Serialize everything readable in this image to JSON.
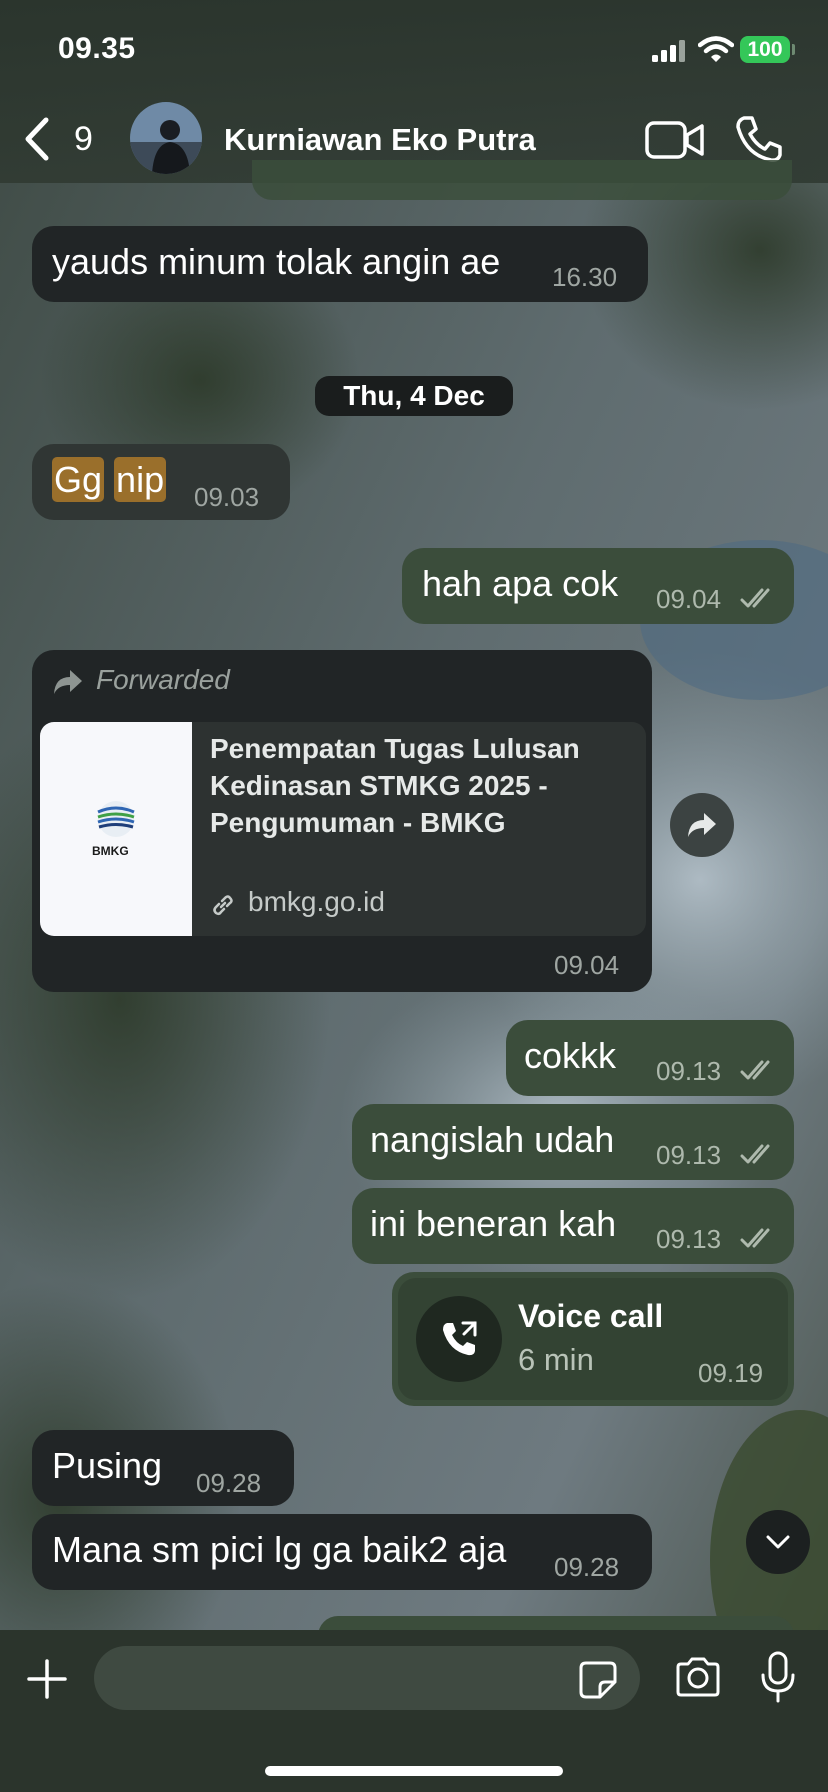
{
  "status": {
    "time": "09.35",
    "battery": "100"
  },
  "header": {
    "back_count": "9",
    "contact_name": "Kurniawan Eko Putra"
  },
  "date_separator": "Thu, 4 Dec",
  "messages": [
    {
      "direction": "in",
      "text": "yauds minum tolak angin ae",
      "time": "16.30"
    },
    {
      "direction": "in",
      "text_parts": [
        "Gg",
        "nip"
      ],
      "time": "09.03"
    },
    {
      "direction": "out",
      "text": "hah apa cok",
      "time": "09.04",
      "status": "read"
    },
    {
      "direction": "in",
      "forwarded_label": "Forwarded",
      "link_title": "Penempatan Tugas Lulusan Kedinasan STMKG 2025 - Pengumuman - BMKG",
      "link_title_lines": [
        "Penempatan Tugas Lulusan",
        "Kedinasan STMKG 2025 -",
        "Pengumuman - BMKG"
      ],
      "link_domain": "bmkg.go.id",
      "logo_text": "BMKG",
      "time": "09.04"
    },
    {
      "direction": "out",
      "text": "cokkk",
      "time": "09.13",
      "status": "read"
    },
    {
      "direction": "out",
      "text": "nangislah udah",
      "time": "09.13",
      "status": "read"
    },
    {
      "direction": "out",
      "text": "ini beneran kah",
      "time": "09.13",
      "status": "read"
    },
    {
      "direction": "out",
      "call_title": "Voice call",
      "call_duration": "6 min",
      "time": "09.19"
    },
    {
      "direction": "in",
      "text": "Pusing",
      "time": "09.28"
    },
    {
      "direction": "in",
      "text": "Mana sm pici lg ga baik2 aja",
      "time": "09.28"
    }
  ],
  "composer": {
    "placeholder": ""
  },
  "colors": {
    "incoming_bubble": "#212526",
    "outgoing_bubble": "#3b4d3b",
    "battery": "#34c759",
    "highlight": "#9a6f2b"
  },
  "icons": [
    "back-chevron-icon",
    "video-call-icon",
    "phone-icon",
    "share-icon",
    "forward-arrow-icon",
    "link-icon",
    "call-outgoing-icon",
    "chevron-down-icon",
    "plus-icon",
    "sticker-icon",
    "camera-icon",
    "microphone-icon"
  ]
}
